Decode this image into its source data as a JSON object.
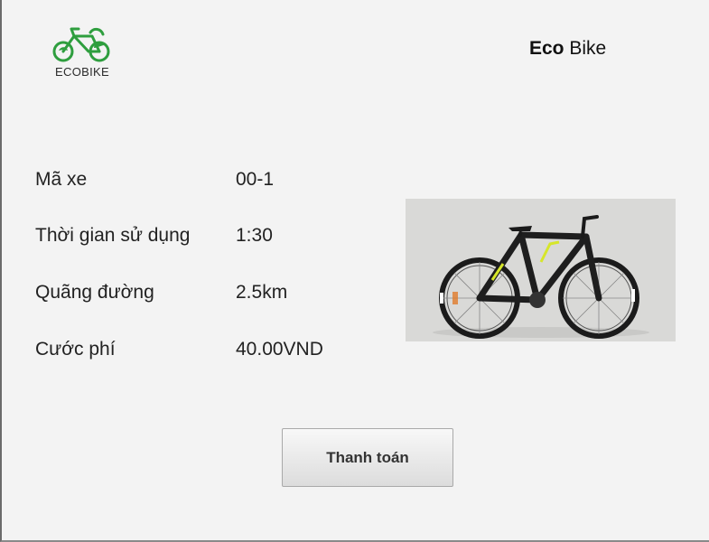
{
  "header": {
    "logo_text": "ECOBIKE",
    "brand_bold": "Eco",
    "brand_rest": " Bike"
  },
  "details": [
    {
      "label": "Mã xe",
      "value": "00-1"
    },
    {
      "label": "Thời gian sử dụng",
      "value": "1:30"
    },
    {
      "label": "Quãng đường",
      "value": "2.5km"
    },
    {
      "label": "Cước phí",
      "value": "40.00VND"
    }
  ],
  "actions": {
    "pay_label": "Thanh toán"
  },
  "colors": {
    "logo_green": "#2e9e3e",
    "bike_accent": "#d6e62a",
    "background": "#f3f3f3"
  }
}
